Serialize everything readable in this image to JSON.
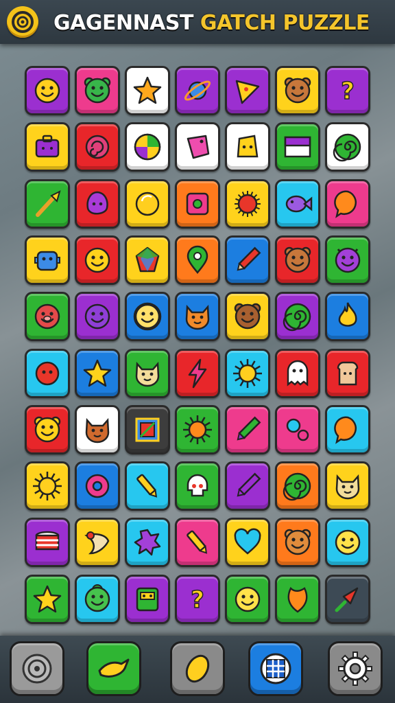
{
  "header": {
    "title_part1": "GAGENNAST",
    "title_part2": "GATCH PUZZLE",
    "logo_icon": "target-icon",
    "title_color_1": "#ffffff",
    "title_color_2": "#f4c52c"
  },
  "grid": {
    "rows": 10,
    "cols": 7,
    "tiles": [
      [
        {
          "icon": "smiley-face-icon",
          "bg": "#9b2fd0"
        },
        {
          "icon": "green-monster-icon",
          "bg": "#ee3b8d"
        },
        {
          "icon": "orange-star-icon",
          "bg": "#ffffff"
        },
        {
          "icon": "planet-icon",
          "bg": "#9b2fd0"
        },
        {
          "icon": "pizza-slice-icon",
          "bg": "#9b2fd0"
        },
        {
          "icon": "bear-face-icon",
          "bg": "#ffd21c"
        },
        {
          "icon": "question-mark-icon",
          "bg": "#9b2fd0"
        }
      ],
      [
        {
          "icon": "purple-box-icon",
          "bg": "#ffd21c"
        },
        {
          "icon": "swirl-shell-icon",
          "bg": "#e8262a"
        },
        {
          "icon": "beach-ball-icon",
          "bg": "#ffffff"
        },
        {
          "icon": "pink-gem-icon",
          "bg": "#ffffff"
        },
        {
          "icon": "cheese-face-icon",
          "bg": "#ffffff"
        },
        {
          "icon": "flag-icon",
          "bg": "#2fb533"
        },
        {
          "icon": "spiral-icon",
          "bg": "#ffffff"
        }
      ],
      [
        {
          "icon": "brush-icon",
          "bg": "#2fb533"
        },
        {
          "icon": "purple-blob-icon",
          "bg": "#e8262a"
        },
        {
          "icon": "yellow-orb-icon",
          "bg": "#ffd21c"
        },
        {
          "icon": "pink-square-icon",
          "bg": "#ff7a1c"
        },
        {
          "icon": "red-urchin-icon",
          "bg": "#ffd21c"
        },
        {
          "icon": "purple-fish-icon",
          "bg": "#27c7ef"
        },
        {
          "icon": "orange-bubble-icon",
          "bg": "#ee3b8d"
        }
      ],
      [
        {
          "icon": "blue-robot-icon",
          "bg": "#ffd21c"
        },
        {
          "icon": "yellow-smiley-icon",
          "bg": "#e8262a"
        },
        {
          "icon": "gem-icon",
          "bg": "#ffd21c"
        },
        {
          "icon": "map-pin-icon",
          "bg": "#ff7a1c"
        },
        {
          "icon": "pencil-icon",
          "bg": "#1c7ee0"
        },
        {
          "icon": "bear-face-icon",
          "bg": "#e8262a"
        },
        {
          "icon": "purple-devil-icon",
          "bg": "#2fb533"
        }
      ],
      [
        {
          "icon": "red-pig-icon",
          "bg": "#2fb533"
        },
        {
          "icon": "purple-fuzzy-icon",
          "bg": "#9b2fd0"
        },
        {
          "icon": "lion-face-icon",
          "bg": "#1c7ee0"
        },
        {
          "icon": "fox-face-icon",
          "bg": "#1c7ee0"
        },
        {
          "icon": "brown-dog-icon",
          "bg": "#ffd21c"
        },
        {
          "icon": "spiral-icon",
          "bg": "#9b2fd0"
        },
        {
          "icon": "flame-icon",
          "bg": "#1c7ee0"
        }
      ],
      [
        {
          "icon": "red-ball-face-icon",
          "bg": "#27c7ef"
        },
        {
          "icon": "star-icon",
          "bg": "#1c7ee0"
        },
        {
          "icon": "cat-face-icon",
          "bg": "#2fb533"
        },
        {
          "icon": "lightning-icon",
          "bg": "#e8262a"
        },
        {
          "icon": "sun-icon",
          "bg": "#27c7ef"
        },
        {
          "icon": "ghost-icon",
          "bg": "#e8262a"
        },
        {
          "icon": "toast-icon",
          "bg": "#e8262a"
        }
      ],
      [
        {
          "icon": "yellow-bear-icon",
          "bg": "#e8262a"
        },
        {
          "icon": "orange-cat-icon",
          "bg": "#ffffff"
        },
        {
          "icon": "framed-picture-icon",
          "bg": "#3d3d3d"
        },
        {
          "icon": "orange-sun-icon",
          "bg": "#2fb533"
        },
        {
          "icon": "green-pencil-icon",
          "bg": "#ee3b8d"
        },
        {
          "icon": "bubbles-icon",
          "bg": "#ee3b8d"
        },
        {
          "icon": "orange-bubble-icon",
          "bg": "#27c7ef"
        }
      ],
      [
        {
          "icon": "sun-icon",
          "bg": "#ffd21c"
        },
        {
          "icon": "donut-icon",
          "bg": "#1c7ee0"
        },
        {
          "icon": "crayon-icon",
          "bg": "#27c7ef"
        },
        {
          "icon": "skull-icon",
          "bg": "#2fb533"
        },
        {
          "icon": "purple-crayon-icon",
          "bg": "#9b2fd0"
        },
        {
          "icon": "spiral-icon",
          "bg": "#ff7a1c"
        },
        {
          "icon": "cat-face-icon",
          "bg": "#ffd21c"
        }
      ],
      [
        {
          "icon": "stacked-plates-icon",
          "bg": "#9b2fd0"
        },
        {
          "icon": "cornucopia-icon",
          "bg": "#ffd21c"
        },
        {
          "icon": "purple-splat-icon",
          "bg": "#27c7ef"
        },
        {
          "icon": "crayon-icon",
          "bg": "#ee3b8d"
        },
        {
          "icon": "blue-heart-icon",
          "bg": "#ffd21c"
        },
        {
          "icon": "orange-bear-icon",
          "bg": "#ff7a1c"
        },
        {
          "icon": "yellow-face-icon",
          "bg": "#27c7ef"
        }
      ],
      [
        {
          "icon": "star-icon",
          "bg": "#2fb533"
        },
        {
          "icon": "green-troll-icon",
          "bg": "#27c7ef"
        },
        {
          "icon": "robot-box-icon",
          "bg": "#9b2fd0"
        },
        {
          "icon": "question-mark-icon",
          "bg": "#9b2fd0"
        },
        {
          "icon": "yellow-face-icon",
          "bg": "#2fb533"
        },
        {
          "icon": "orange-leaf-icon",
          "bg": "#2fb533"
        },
        {
          "icon": "rocket-icon",
          "bg": "#3d4a55"
        }
      ]
    ]
  },
  "bottom_nav": [
    {
      "icon": "target-icon",
      "bg": "#9a9a9a"
    },
    {
      "icon": "bird-icon",
      "bg": "#2fb533"
    },
    {
      "icon": "lemon-icon",
      "bg": "#8a8a8a"
    },
    {
      "icon": "grid-globe-icon",
      "bg": "#1c7ee0"
    },
    {
      "icon": "gear-icon",
      "bg": "#8a8a8a"
    }
  ]
}
